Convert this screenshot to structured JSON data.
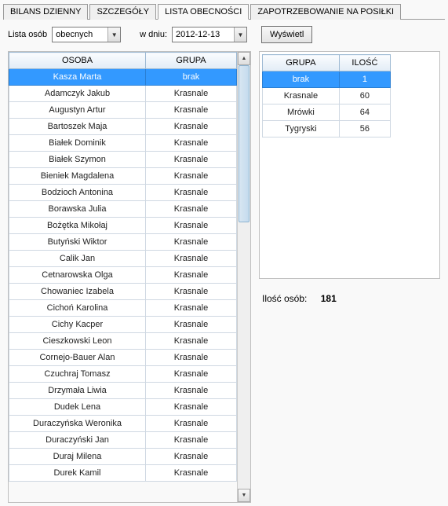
{
  "tabs": {
    "t0": "BILANS DZIENNY",
    "t1": "SZCZEGÓŁY",
    "t2": "LISTA OBECNOŚCI",
    "t3": "ZAPOTRZEBOWANIE NA POSIŁKI"
  },
  "toolbar": {
    "list_label": "Lista osób",
    "list_value": "obecnych",
    "day_label": "w dniu:",
    "date_value": "2012-12-13",
    "show_btn": "Wyświetl"
  },
  "people_headers": {
    "osoba": "OSOBA",
    "grupa": "GRUPA"
  },
  "people": [
    {
      "name": "Kasza Marta",
      "group": "brak",
      "selected": true
    },
    {
      "name": "Adamczyk Jakub",
      "group": "Krasnale"
    },
    {
      "name": "Augustyn Artur",
      "group": "Krasnale"
    },
    {
      "name": "Bartoszek Maja",
      "group": "Krasnale"
    },
    {
      "name": "Białek Dominik",
      "group": "Krasnale"
    },
    {
      "name": "Białek Szymon",
      "group": "Krasnale"
    },
    {
      "name": "Bieniek Magdalena",
      "group": "Krasnale"
    },
    {
      "name": "Bodzioch Antonina",
      "group": "Krasnale"
    },
    {
      "name": "Borawska Julia",
      "group": "Krasnale"
    },
    {
      "name": "Bożętka Mikołaj",
      "group": "Krasnale"
    },
    {
      "name": "Butyński Wiktor",
      "group": "Krasnale"
    },
    {
      "name": "Calik Jan",
      "group": "Krasnale"
    },
    {
      "name": "Cetnarowska Olga",
      "group": "Krasnale"
    },
    {
      "name": "Chowaniec Izabela",
      "group": "Krasnale"
    },
    {
      "name": "Cichoń Karolina",
      "group": "Krasnale"
    },
    {
      "name": "Cichy Kacper",
      "group": "Krasnale"
    },
    {
      "name": "Cieszkowski Leon",
      "group": "Krasnale"
    },
    {
      "name": "Cornejo-Bauer Alan",
      "group": "Krasnale"
    },
    {
      "name": "Czuchraj Tomasz",
      "group": "Krasnale"
    },
    {
      "name": "Drzymała Liwia",
      "group": "Krasnale"
    },
    {
      "name": "Dudek Lena",
      "group": "Krasnale"
    },
    {
      "name": "Duraczyńska Weronika",
      "group": "Krasnale"
    },
    {
      "name": "Duraczyński Jan",
      "group": "Krasnale"
    },
    {
      "name": "Duraj Milena",
      "group": "Krasnale"
    },
    {
      "name": "Durek Kamil",
      "group": "Krasnale"
    }
  ],
  "summary_headers": {
    "grupa": "GRUPA",
    "ilosc": "ILOŚĆ"
  },
  "summary": [
    {
      "group": "brak",
      "count": "1",
      "selected": true
    },
    {
      "group": "Krasnale",
      "count": "60"
    },
    {
      "group": "Mrówki",
      "count": "64"
    },
    {
      "group": "Tygryski",
      "count": "56"
    }
  ],
  "count_label": "Ilość osób:",
  "count_value": "181"
}
